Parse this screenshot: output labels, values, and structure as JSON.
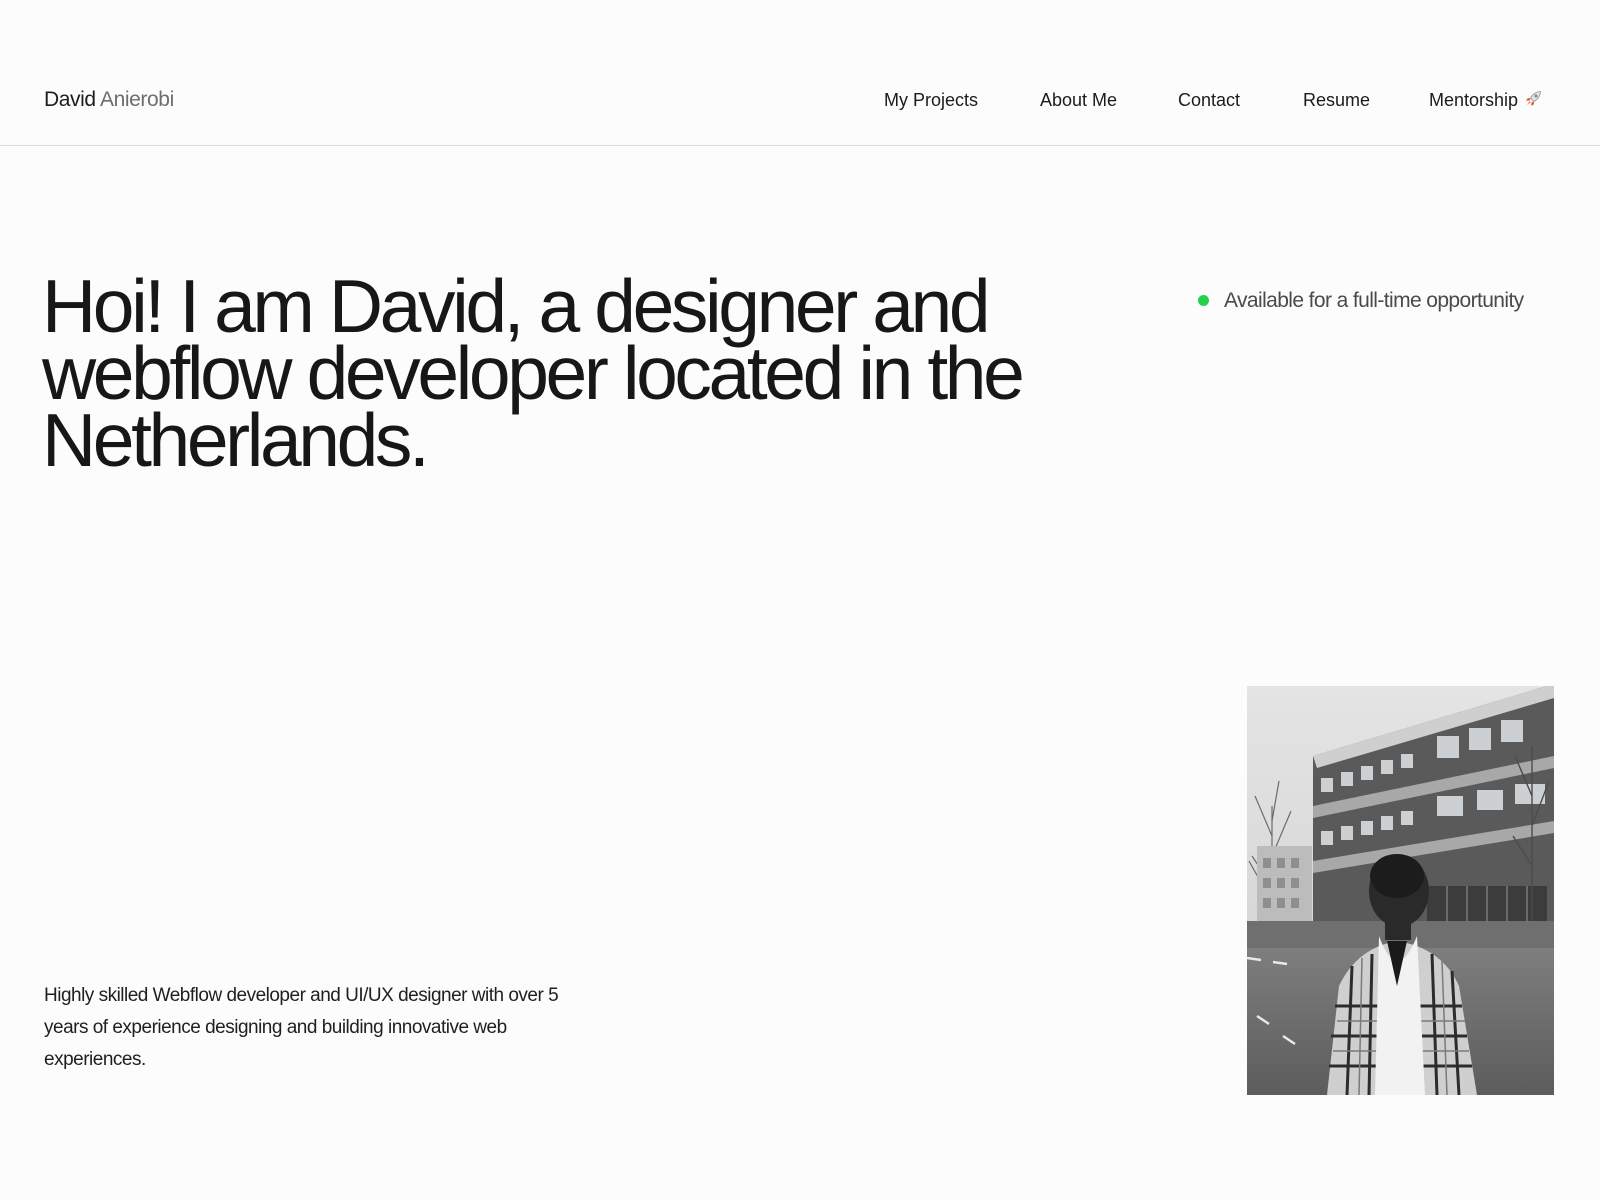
{
  "header": {
    "logo": {
      "first_name": "David",
      "last_name": "Anierobi"
    },
    "nav": [
      {
        "label": "My Projects"
      },
      {
        "label": "About Me"
      },
      {
        "label": "Contact"
      },
      {
        "label": "Resume"
      },
      {
        "label": "Mentorship",
        "icon": "rocket-icon"
      }
    ]
  },
  "hero": {
    "title": "Hoi! I am David, a designer and webflow developer located in the Netherlands.",
    "availability": {
      "text": "Available for a full-time opportunity",
      "status_color": "#22d14a"
    }
  },
  "bio": {
    "text": "Highly skilled Webflow developer and UI/UX designer with over 5 years of experience designing and building innovative web experiences."
  },
  "colors": {
    "background": "#fdfcfc",
    "text": "#1b1b1b",
    "muted": "#6e6e6e",
    "divider": "#dcdcdc"
  }
}
